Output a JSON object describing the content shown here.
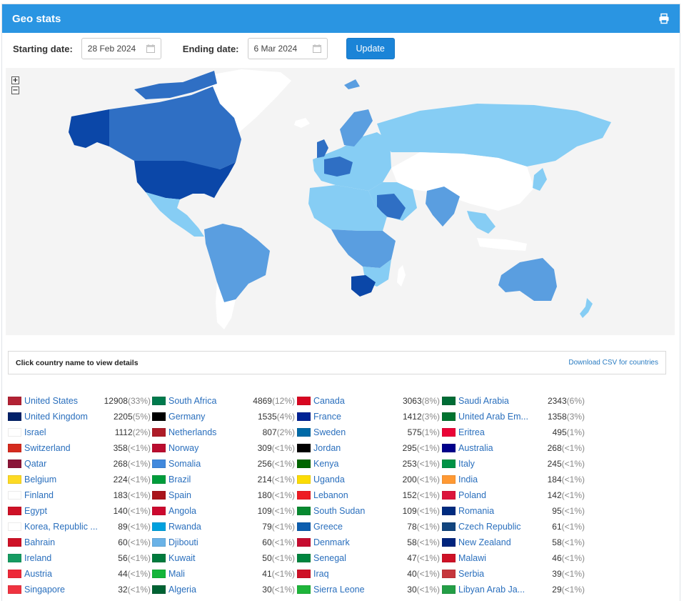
{
  "header": {
    "title": "Geo stats",
    "print_icon": "print-icon"
  },
  "filters": {
    "start_label": "Starting date:",
    "start_value": "28 Feb 2024",
    "end_label": "Ending date:",
    "end_value": "6 Mar 2024",
    "update_label": "Update"
  },
  "map": {
    "zoom_in": "+",
    "zoom_out": "−"
  },
  "info": {
    "text": "Click country name to view details",
    "csv_link": "Download CSV for countries"
  },
  "colors": {
    "header": "#2a95e2",
    "map_dark": "#0b47a8",
    "map_mid": "#2f6fc4",
    "map_med": "#5a9ee0",
    "map_light": "#86cdf4",
    "map_none": "#ffffff",
    "link": "#2a6fbd"
  },
  "columns": [
    [
      {
        "name": "United States",
        "value": "12908",
        "pct": "(33%)"
      },
      {
        "name": "United Kingdom",
        "value": "2205",
        "pct": "(5%)"
      },
      {
        "name": "Israel",
        "value": "1112",
        "pct": "(2%)"
      },
      {
        "name": "Switzerland",
        "value": "358",
        "pct": "(<1%)"
      },
      {
        "name": "Qatar",
        "value": "268",
        "pct": "(<1%)"
      },
      {
        "name": "Belgium",
        "value": "224",
        "pct": "(<1%)"
      },
      {
        "name": "Finland",
        "value": "183",
        "pct": "(<1%)"
      },
      {
        "name": "Egypt",
        "value": "140",
        "pct": "(<1%)"
      },
      {
        "name": "Korea, Republic ...",
        "value": "89",
        "pct": "(<1%)"
      },
      {
        "name": "Bahrain",
        "value": "60",
        "pct": "(<1%)"
      },
      {
        "name": "Ireland",
        "value": "56",
        "pct": "(<1%)"
      },
      {
        "name": "Austria",
        "value": "44",
        "pct": "(<1%)"
      },
      {
        "name": "Singapore",
        "value": "32",
        "pct": "(<1%)"
      }
    ],
    [
      {
        "name": "South Africa",
        "value": "4869",
        "pct": "(12%)"
      },
      {
        "name": "Germany",
        "value": "1535",
        "pct": "(4%)"
      },
      {
        "name": "Netherlands",
        "value": "807",
        "pct": "(2%)"
      },
      {
        "name": "Norway",
        "value": "309",
        "pct": "(<1%)"
      },
      {
        "name": "Somalia",
        "value": "256",
        "pct": "(<1%)"
      },
      {
        "name": "Brazil",
        "value": "214",
        "pct": "(<1%)"
      },
      {
        "name": "Spain",
        "value": "180",
        "pct": "(<1%)"
      },
      {
        "name": "Angola",
        "value": "109",
        "pct": "(<1%)"
      },
      {
        "name": "Rwanda",
        "value": "79",
        "pct": "(<1%)"
      },
      {
        "name": "Djibouti",
        "value": "60",
        "pct": "(<1%)"
      },
      {
        "name": "Kuwait",
        "value": "50",
        "pct": "(<1%)"
      },
      {
        "name": "Mali",
        "value": "41",
        "pct": "(<1%)"
      },
      {
        "name": "Algeria",
        "value": "30",
        "pct": "(<1%)"
      }
    ],
    [
      {
        "name": "Canada",
        "value": "3063",
        "pct": "(8%)"
      },
      {
        "name": "France",
        "value": "1412",
        "pct": "(3%)"
      },
      {
        "name": "Sweden",
        "value": "575",
        "pct": "(1%)"
      },
      {
        "name": "Jordan",
        "value": "295",
        "pct": "(<1%)"
      },
      {
        "name": "Kenya",
        "value": "253",
        "pct": "(<1%)"
      },
      {
        "name": "Uganda",
        "value": "200",
        "pct": "(<1%)"
      },
      {
        "name": "Lebanon",
        "value": "152",
        "pct": "(<1%)"
      },
      {
        "name": "South Sudan",
        "value": "109",
        "pct": "(<1%)"
      },
      {
        "name": "Greece",
        "value": "78",
        "pct": "(<1%)"
      },
      {
        "name": "Denmark",
        "value": "58",
        "pct": "(<1%)"
      },
      {
        "name": "Senegal",
        "value": "47",
        "pct": "(<1%)"
      },
      {
        "name": "Iraq",
        "value": "40",
        "pct": "(<1%)"
      },
      {
        "name": "Sierra Leone",
        "value": "30",
        "pct": "(<1%)"
      }
    ],
    [
      {
        "name": "Saudi Arabia",
        "value": "2343",
        "pct": "(6%)"
      },
      {
        "name": "United Arab Em...",
        "value": "1358",
        "pct": "(3%)"
      },
      {
        "name": "Eritrea",
        "value": "495",
        "pct": "(1%)"
      },
      {
        "name": "Australia",
        "value": "268",
        "pct": "(<1%)"
      },
      {
        "name": "Italy",
        "value": "245",
        "pct": "(<1%)"
      },
      {
        "name": "India",
        "value": "184",
        "pct": "(<1%)"
      },
      {
        "name": "Poland",
        "value": "142",
        "pct": "(<1%)"
      },
      {
        "name": "Romania",
        "value": "95",
        "pct": "(<1%)"
      },
      {
        "name": "Czech Republic",
        "value": "61",
        "pct": "(<1%)"
      },
      {
        "name": "New Zealand",
        "value": "58",
        "pct": "(<1%)"
      },
      {
        "name": "Malawi",
        "value": "46",
        "pct": "(<1%)"
      },
      {
        "name": "Serbia",
        "value": "39",
        "pct": "(<1%)"
      },
      {
        "name": "Libyan Arab Ja...",
        "value": "29",
        "pct": "(<1%)"
      }
    ]
  ]
}
